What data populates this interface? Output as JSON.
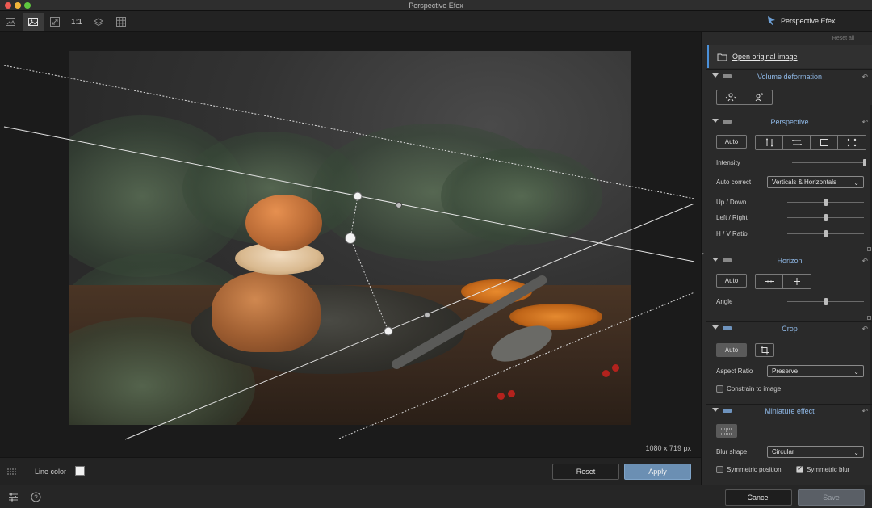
{
  "window": {
    "title": "Perspective Efex"
  },
  "brand": {
    "name": "Perspective Efex"
  },
  "toolbar": {
    "zoom_label": "1:1"
  },
  "canvas": {
    "dimensions": "1080 x 719 px"
  },
  "canvas_footer": {
    "line_color_label": "Line color",
    "reset_label": "Reset",
    "apply_label": "Apply"
  },
  "bottombar": {
    "cancel_label": "Cancel",
    "save_label": "Save"
  },
  "panel": {
    "reset_all": "Reset all",
    "open_original": "Open original image",
    "volume": {
      "title": "Volume deformation"
    },
    "perspective": {
      "title": "Perspective",
      "auto_label": "Auto",
      "intensity_label": "Intensity",
      "intensity_value": 1.0,
      "auto_correct_label": "Auto correct",
      "auto_correct_value": "Verticals & Horizontals",
      "up_down_label": "Up / Down",
      "up_down_value": 0.5,
      "left_right_label": "Left / Right",
      "left_right_value": 0.5,
      "hv_ratio_label": "H / V Ratio",
      "hv_ratio_value": 0.5
    },
    "horizon": {
      "title": "Horizon",
      "auto_label": "Auto",
      "angle_label": "Angle",
      "angle_value": 0.5
    },
    "crop": {
      "title": "Crop",
      "auto_label": "Auto",
      "aspect_ratio_label": "Aspect Ratio",
      "aspect_ratio_value": "Preserve",
      "constrain_label": "Constrain to image",
      "constrain_checked": false
    },
    "miniature": {
      "title": "Miniature effect",
      "blur_shape_label": "Blur shape",
      "blur_shape_value": "Circular",
      "symmetric_position_label": "Symmetric position",
      "symmetric_position_checked": false,
      "symmetric_blur_label": "Symmetric blur",
      "symmetric_blur_checked": true
    }
  },
  "colors": {
    "accent": "#6b8fb3",
    "section_title": "#8fb8e6",
    "highlight": "#4a90d9"
  }
}
